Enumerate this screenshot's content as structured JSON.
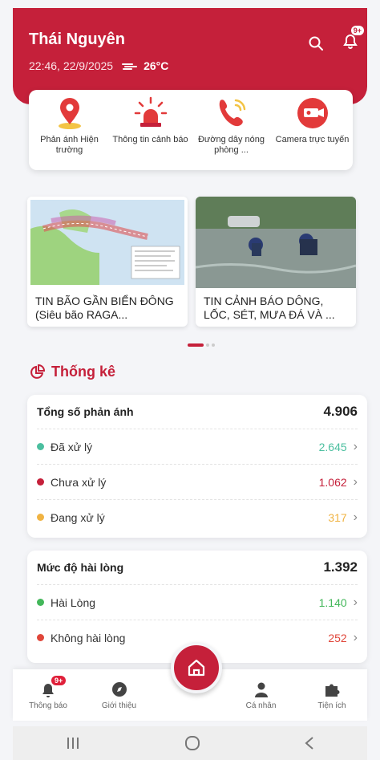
{
  "header": {
    "location": "Thái Nguyên",
    "datetime": "22:46, 22/9/2025",
    "temperature": "26°C",
    "notif_badge": "9+"
  },
  "quick_actions": [
    {
      "label": "Phản ánh Hiện trường",
      "icon": "map-pin-icon"
    },
    {
      "label": "Thông tin cảnh báo",
      "icon": "alarm-siren-icon"
    },
    {
      "label": "Đường dây nóng phòng ...",
      "icon": "phone-ringing-icon"
    },
    {
      "label": "Camera trực tuyến",
      "icon": "camera-icon"
    }
  ],
  "news": [
    {
      "title": "TIN BÃO GẦN BIỂN ĐÔNG (Siêu bão RAGA..."
    },
    {
      "title": "TIN CẢNH BÁO DÔNG, LỐC, SÉT, MƯA ĐÁ VÀ ..."
    }
  ],
  "stats": {
    "title": "Thống kê",
    "total": {
      "label": "Tổng số phản ánh",
      "value": "4.906",
      "rows": [
        {
          "label": "Đã xử lý",
          "value": "2.645",
          "color": "#4bbf9f"
        },
        {
          "label": "Chưa xử lý",
          "value": "1.062",
          "color": "#c5203a"
        },
        {
          "label": "Đang xử lý",
          "value": "317",
          "color": "#f0b342"
        }
      ]
    },
    "satisfaction": {
      "label": "Mức độ hài lòng",
      "value": "1.392",
      "rows": [
        {
          "label": "Hài Lòng",
          "value": "1.140",
          "color": "#43b75a"
        },
        {
          "label": "Không hài lòng",
          "value": "252",
          "color": "#e0463a"
        }
      ]
    }
  },
  "tabs": [
    {
      "label": "Thông báo",
      "badge": "9+"
    },
    {
      "label": "Giới thiệu"
    },
    {
      "label": "Cá nhân"
    },
    {
      "label": "Tiện ích"
    }
  ],
  "colors": {
    "accent": "#c5203a"
  }
}
